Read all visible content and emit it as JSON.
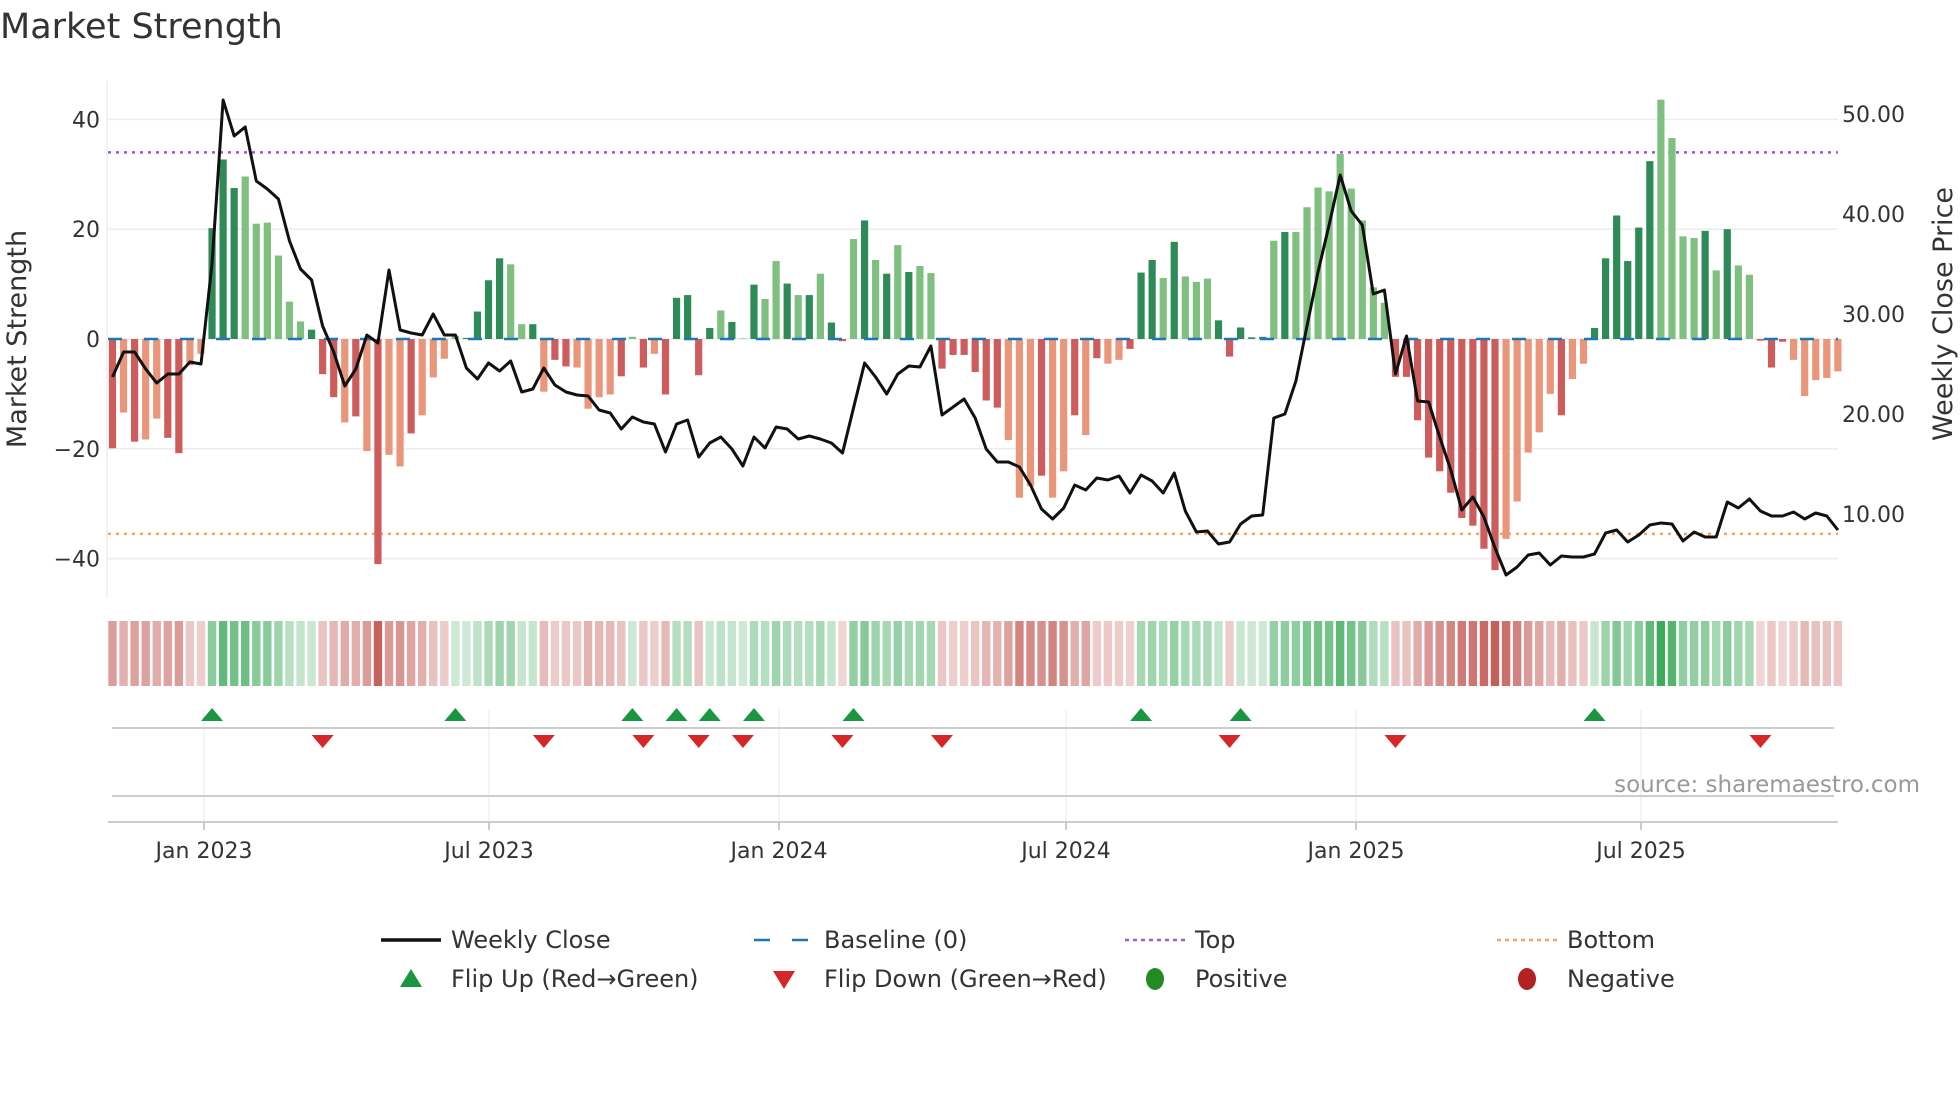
{
  "chart_data": {
    "type": "bar",
    "title": "Market Strength",
    "ylabel": "Market Strength",
    "y2label": "Weekly Close Price",
    "ylim": [
      -47,
      47
    ],
    "y2lim": [
      2.5,
      56
    ],
    "yticks": [
      40,
      20,
      0,
      -20,
      -40
    ],
    "ytick_labels": [
      "40",
      "20",
      "0",
      "−20",
      "−40"
    ],
    "y2ticks": [
      50,
      40,
      30,
      20,
      10
    ],
    "y2tick_labels": [
      "50.00",
      "40.00",
      "30.00",
      "20.00",
      "10.00"
    ],
    "xtick_labels": [
      "Jan 2023",
      "Jul 2023",
      "Jan 2024",
      "Jul 2024",
      "Jan 2025",
      "Jul 2025"
    ],
    "xtick_week_index": [
      9.2,
      35,
      61.2,
      87.2,
      113.4,
      139.2
    ],
    "top_level": 34,
    "bottom_level": -35.5,
    "baseline": 0,
    "strength": [
      -19.9,
      -13.4,
      -18.7,
      -18.3,
      -14.5,
      -18,
      -20.8,
      -4.8,
      -2.7,
      20.2,
      32.7,
      27.5,
      29.6,
      21,
      21.2,
      15.2,
      6.8,
      3.2,
      1.7,
      -6.4,
      -10.6,
      -15.2,
      -14.1,
      -20.4,
      -41,
      -21.1,
      -23.2,
      -17.2,
      -13.9,
      -7,
      -3.6,
      0.6,
      0.2,
      5,
      10.7,
      14.7,
      13.6,
      2.7,
      2.7,
      -9.6,
      -3.8,
      -5,
      -5.2,
      -12.7,
      -10.6,
      -10.1,
      -6.8,
      0.4,
      -5.2,
      -2.7,
      -10.1,
      7.5,
      8,
      -6.6,
      2,
      5.2,
      3.1,
      0.1,
      9.9,
      7.3,
      14.2,
      10.1,
      8,
      8,
      11.9,
      3,
      -0.4,
      18.2,
      21.6,
      14.4,
      11.9,
      17.1,
      12.2,
      13.3,
      12,
      -5.4,
      -2.9,
      -2.9,
      -6,
      -11.2,
      -12.5,
      -18.4,
      -28.9,
      -26.8,
      -24.9,
      -28.9,
      -24.1,
      -13.9,
      -17.5,
      -3.5,
      -4.5,
      -3.8,
      -1.8,
      12.1,
      14.4,
      11.1,
      17.7,
      11.4,
      10.4,
      11,
      3.4,
      -3.2,
      2.1,
      0.3,
      0.4,
      17.9,
      19.5,
      19.5,
      24,
      27.6,
      26.9,
      33.7,
      27.4,
      21.6,
      9.4,
      6.6,
      -6.9,
      -6.9,
      -14.8,
      -21.6,
      -24.1,
      -28,
      -32.6,
      -34,
      -38.2,
      -42.1,
      -36.4,
      -29.6,
      -20.7,
      -17,
      -10,
      -13.9,
      -7.3,
      -4.5,
      2,
      14.7,
      22.5,
      14.2,
      20.3,
      32.4,
      43.6,
      36.6,
      18.7,
      18.4,
      19.7,
      12.5,
      20,
      13.4,
      11.7,
      -0.3,
      -5.2,
      -0.5,
      -3.8,
      -10.4,
      -7.5,
      -7.1,
      -5.9
    ],
    "strength_shade": "dldllddlldddlllllldddldldlldllllddddlldlddlllldldldddddldldlldldlddldldldllddddddllldlldldlldddldllldddddldlllllllllddddddddddllllldllddddddlllldldlldddllll",
    "weekly_close": [
      23.7,
      26.2,
      26.2,
      24.5,
      23.1,
      24,
      24,
      25.2,
      25,
      35,
      51.4,
      47.8,
      48.7,
      43.3,
      42.5,
      41.5,
      37.3,
      34.5,
      33.4,
      28.8,
      26.2,
      22.8,
      24.5,
      27.9,
      27.1,
      34.4,
      28.4,
      28.1,
      27.9,
      30,
      27.9,
      27.9,
      24.6,
      23.5,
      25.1,
      24.3,
      25.3,
      22.2,
      22.5,
      24.6,
      22.9,
      22.2,
      21.9,
      21.8,
      20.4,
      20.1,
      18.5,
      19.7,
      19.2,
      19,
      16.2,
      19,
      19.4,
      15.7,
      17.1,
      17.7,
      16.5,
      14.8,
      17.7,
      16.6,
      18.7,
      18.5,
      17.5,
      17.8,
      17.5,
      17.1,
      16.1,
      20.6,
      25.1,
      23.7,
      22,
      24,
      24.8,
      24.7,
      26.8,
      19.9,
      20.7,
      21.5,
      19.6,
      16.5,
      15.2,
      15.2,
      14.7,
      12.9,
      10.5,
      9.5,
      10.6,
      12.9,
      12.4,
      13.6,
      13.4,
      13.8,
      12.1,
      13.9,
      13.3,
      12.1,
      14.1,
      10.3,
      8.2,
      8.3,
      7,
      7.2,
      9,
      9.8,
      9.9,
      19.6,
      20,
      23.3,
      28.8,
      34.2,
      38.9,
      43.9,
      40.3,
      38.9,
      32,
      32.4,
      24,
      27.8,
      21.3,
      21.2,
      17.7,
      14.4,
      10.4,
      11.7,
      9.7,
      6.6,
      3.9,
      4.7,
      5.9,
      6.1,
      4.9,
      5.8,
      5.7,
      5.7,
      6,
      8.1,
      8.4,
      7.2,
      7.9,
      8.9,
      9.1,
      9,
      7.3,
      8.2,
      7.7,
      7.7,
      11.2,
      10.6,
      11.5,
      10.3,
      9.8,
      9.8,
      10.2,
      9.5,
      10.1,
      9.8,
      8.4
    ],
    "flip_up_index": [
      9,
      31,
      47,
      51,
      54,
      58,
      67,
      93,
      102,
      134
    ],
    "flip_down_index": [
      19,
      39,
      48,
      53,
      57,
      66,
      75,
      101,
      116,
      149
    ],
    "legend": {
      "placement": "bottom",
      "items": [
        {
          "label": "Weekly Close",
          "symbol": "line"
        },
        {
          "label": "Baseline (0)",
          "symbol": "dash"
        },
        {
          "label": "Top",
          "symbol": "dot-purple"
        },
        {
          "label": "Bottom",
          "symbol": "dot-orange"
        },
        {
          "label": "Flip Up (Red→Green)",
          "symbol": "triangle-up"
        },
        {
          "label": "Flip Down (Green→Red)",
          "symbol": "triangle-down"
        },
        {
          "label": "Positive",
          "symbol": "circle-green"
        },
        {
          "label": "Negative",
          "symbol": "circle-red"
        }
      ]
    },
    "source": "source: sharemaestro.com",
    "colors": {
      "pos_dark": "#2e8b57",
      "pos_light": "#7fbf7f",
      "neg_dark": "#cd5c5c",
      "neg_light": "#e9967a",
      "line": "#111111",
      "baseline": "#1f77b4",
      "top": "#9b59d0",
      "bottom": "#f4a460",
      "flip_up": "#1a9641",
      "flip_down": "#d62728",
      "positive": "#228b22",
      "negative": "#b22222"
    }
  }
}
